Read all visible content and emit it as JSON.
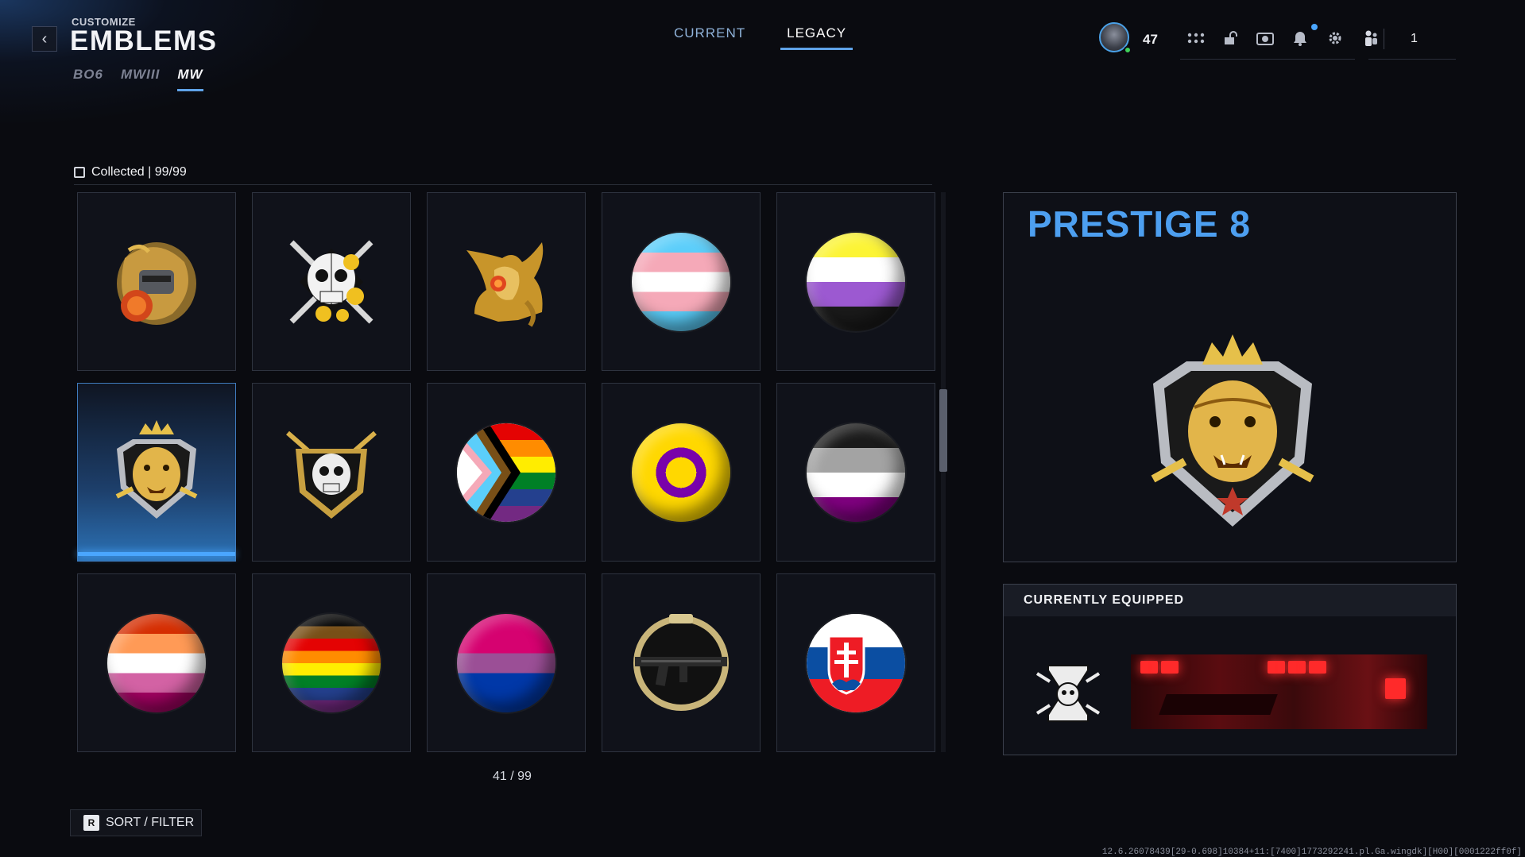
{
  "header": {
    "subtitle": "CUSTOMIZE",
    "title": "EMBLEMS",
    "back_icon": "chevron-left-icon"
  },
  "game_tabs": [
    {
      "label": "BO6",
      "active": false
    },
    {
      "label": "MWIII",
      "active": false
    },
    {
      "label": "MW",
      "active": true
    }
  ],
  "top_tabs": [
    {
      "label": "CURRENT",
      "active": false
    },
    {
      "label": "LEGACY",
      "active": true
    }
  ],
  "top_right": {
    "level": "47",
    "icons": [
      "apps-grid-icon",
      "unlock-icon",
      "camera-icon",
      "bell-icon",
      "gear-icon",
      "party-icon"
    ],
    "party_count": "1"
  },
  "collection": {
    "label": "Collected | 99/99"
  },
  "emblems": [
    {
      "name": "snake-helmet-emblem"
    },
    {
      "name": "skull-roses-emblem"
    },
    {
      "name": "golden-dragon-emblem"
    },
    {
      "name": "trans-pride-flag-emblem"
    },
    {
      "name": "nonbinary-flag-emblem"
    },
    {
      "name": "prestige-8-tiger-emblem",
      "selected": true
    },
    {
      "name": "skull-crest-emblem"
    },
    {
      "name": "progress-pride-flag-emblem"
    },
    {
      "name": "intersex-flag-emblem"
    },
    {
      "name": "asexual-flag-emblem"
    },
    {
      "name": "lesbian-flag-emblem"
    },
    {
      "name": "philly-pride-flag-emblem"
    },
    {
      "name": "bisexual-flag-emblem"
    },
    {
      "name": "mw-rifle-emblem"
    },
    {
      "name": "slovakia-flag-emblem"
    }
  ],
  "pagination": "41 / 99",
  "sort_filter": {
    "key": "R",
    "label": "SORT / FILTER"
  },
  "preview": {
    "title": "PRESTIGE 8"
  },
  "equipped": {
    "label": "CURRENTLY EQUIPPED"
  },
  "version_string": "12.6.26078439[29-0.698]10384+11:[7400]1773292241.pl.Ga.wingdk][H00][0001222ff0f]",
  "colors": {
    "accent": "#4d9ff0",
    "selected_bar": "#4aa6ff",
    "online": "#3fd15a"
  }
}
